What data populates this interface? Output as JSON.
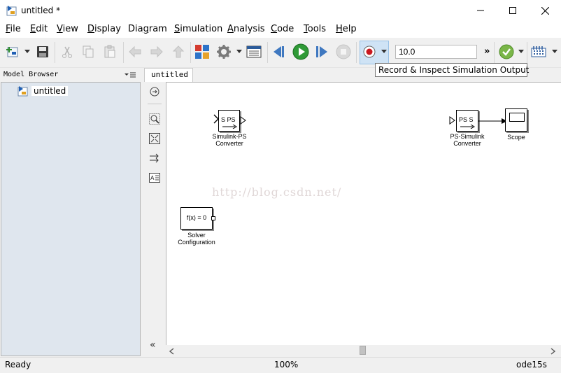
{
  "window": {
    "title": "untitled *",
    "controls": {
      "minimize": "minimize",
      "maximize": "maximize",
      "close": "close"
    }
  },
  "menu": [
    {
      "accel": "F",
      "rest": "ile"
    },
    {
      "accel": "E",
      "rest": "dit"
    },
    {
      "accel": "V",
      "rest": "iew"
    },
    {
      "accel": "D",
      "rest": "isplay"
    },
    {
      "accel": "",
      "pre": "Dia",
      "mid": "g",
      "rest": "ram"
    },
    {
      "accel": "S",
      "rest": "imulation"
    },
    {
      "accel": "A",
      "rest": "nalysis"
    },
    {
      "accel": "C",
      "rest": "ode"
    },
    {
      "accel": "T",
      "rest": "ools"
    },
    {
      "accel": "H",
      "rest": "elp"
    }
  ],
  "toolbar": {
    "stop_time": "10.0",
    "tooltip": "Record & Inspect Simulation Output",
    "overflow": "»"
  },
  "model_browser": {
    "title": "Model Browser",
    "root_item": "untitled"
  },
  "tab": {
    "label": "untitled"
  },
  "canvas": {
    "watermark": "http://blog.csdn.net/",
    "blocks": {
      "s2ps": {
        "glyph": "S PS",
        "label_line1": "Simulink-PS",
        "label_line2": "Converter"
      },
      "ps2s": {
        "glyph": "PS S",
        "label_line1": "PS-Simulink",
        "label_line2": "Converter"
      },
      "scope": {
        "label": "Scope"
      },
      "solver": {
        "glyph": "f(x) = 0",
        "label_line1": "Solver",
        "label_line2": "Configuration"
      }
    }
  },
  "palette": {
    "collapse": "«"
  },
  "status": {
    "state": "Ready",
    "zoom": "100%",
    "solver": "ode15s"
  }
}
